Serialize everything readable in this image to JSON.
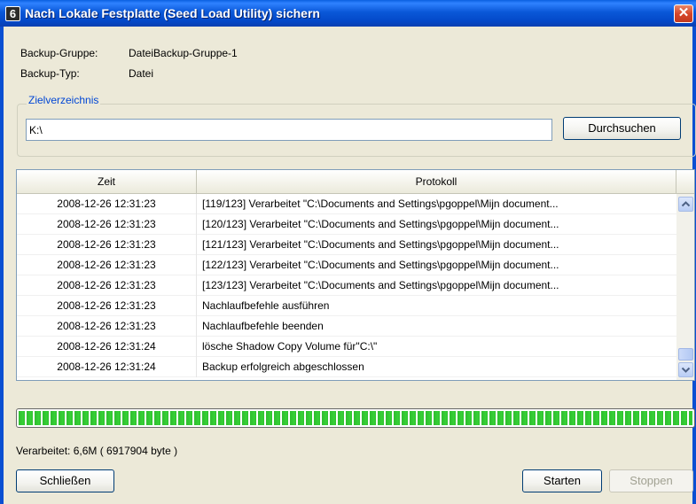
{
  "window": {
    "icon_glyph": "6",
    "title": "Nach Lokale Festplatte (Seed Load Utility) sichern",
    "close_glyph": "✕"
  },
  "info": {
    "group_label": "Backup-Gruppe:",
    "group_value": "DateiBackup-Gruppe-1",
    "type_label": "Backup-Typ:",
    "type_value": "Datei"
  },
  "target": {
    "legend": "Zielverzeichnis",
    "path_value": "K:\\",
    "browse_label": "Durchsuchen"
  },
  "log_table": {
    "col_time": "Zeit",
    "col_log": "Protokoll",
    "rows": [
      {
        "time": "2008-12-26 12:31:23",
        "msg": "[119/123] Verarbeitet \"C:\\Documents and Settings\\pgoppel\\Mijn document..."
      },
      {
        "time": "2008-12-26 12:31:23",
        "msg": "[120/123] Verarbeitet \"C:\\Documents and Settings\\pgoppel\\Mijn document..."
      },
      {
        "time": "2008-12-26 12:31:23",
        "msg": "[121/123] Verarbeitet \"C:\\Documents and Settings\\pgoppel\\Mijn document..."
      },
      {
        "time": "2008-12-26 12:31:23",
        "msg": "[122/123] Verarbeitet \"C:\\Documents and Settings\\pgoppel\\Mijn document..."
      },
      {
        "time": "2008-12-26 12:31:23",
        "msg": "[123/123] Verarbeitet \"C:\\Documents and Settings\\pgoppel\\Mijn document..."
      },
      {
        "time": "2008-12-26 12:31:23",
        "msg": "Nachlaufbefehle ausführen"
      },
      {
        "time": "2008-12-26 12:31:23",
        "msg": "Nachlaufbefehle beenden"
      },
      {
        "time": "2008-12-26 12:31:24",
        "msg": "lösche Shadow Copy Volume für\"C:\\\""
      },
      {
        "time": "2008-12-26 12:31:24",
        "msg": "Backup erfolgreich abgeschlossen"
      }
    ]
  },
  "progress": {
    "percent": 100,
    "color": "#2fbd2f"
  },
  "status": {
    "processed": "Verarbeitet: 6,6M ( 6917904 byte )"
  },
  "buttons": {
    "close_label": "Schließen",
    "start_label": "Starten",
    "stop_label": "Stoppen"
  },
  "colors": {
    "titlebar": "#0a58d8",
    "legend": "#0046d5",
    "dialog_bg": "#ece9d8"
  }
}
